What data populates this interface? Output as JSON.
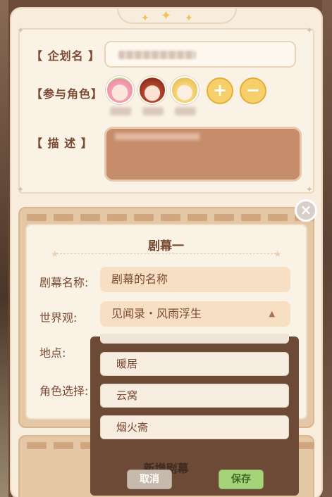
{
  "plan": {
    "name_label": "【 企划名 】",
    "characters_label": "【参与角色】",
    "description_label": "【 描 述 】",
    "add_symbol": "+",
    "remove_symbol": "−"
  },
  "close_symbol": "×",
  "act": {
    "title": "剧幕一",
    "name_label": "剧幕名称:",
    "name_placeholder": "剧幕的名称",
    "worldview_label": "世界观:",
    "worldview_value": "见闻录・风雨浮生",
    "location_label": "地点:",
    "character_label": "角色选择:"
  },
  "location_options": [
    "暖居",
    "云窝",
    "烟火斋"
  ],
  "add_act_text": "新增剧幕",
  "buttons": {
    "cancel": "取消",
    "save": "保存"
  },
  "colors": {
    "accent": "#f6cf6a",
    "save": "#a6d27a",
    "panel": "#e4c7a4"
  }
}
